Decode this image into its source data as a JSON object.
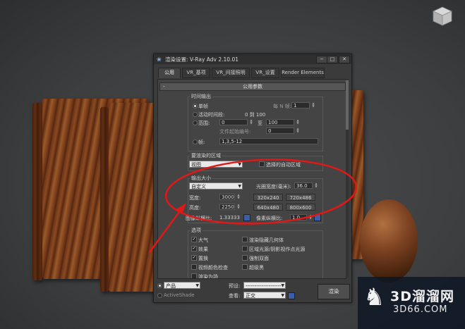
{
  "window": {
    "title": "渲染设置: V-Ray Adv 2.10.01",
    "btn_min": "−",
    "btn_max": "□",
    "btn_close": "✕"
  },
  "tabs": [
    {
      "label": "公用",
      "active": true
    },
    {
      "label": "VR_基项",
      "active": false
    },
    {
      "label": "VR_间接照明",
      "active": false
    },
    {
      "label": "VR_设置",
      "active": false
    },
    {
      "label": "Render Elements",
      "active": false
    }
  ],
  "rollout": {
    "sign": "-",
    "title": "公用参数"
  },
  "time_output": {
    "title": "时间输出",
    "single": "单帧",
    "every_n": "每 N 帧:",
    "every_n_value": "1",
    "active_segment": "活动时间段:",
    "active_segment_value": "0 到 100",
    "range": "范围:",
    "range_from": "0",
    "range_to_label": "至",
    "range_to": "100",
    "file_start": "文件起始编号:",
    "file_start_value": "0",
    "frames": "帧:",
    "frames_value": "1,3,5-12"
  },
  "area": {
    "title": "要渲染的区域",
    "select_value": "视图",
    "auto_region": "选择的自动区域"
  },
  "output_size": {
    "title": "输出大小",
    "preset_value": "自定义",
    "aperture_label": "光圈宽度(毫米):",
    "aperture_value": "36.0",
    "width_label": "宽度:",
    "width_value": "3000",
    "height_label": "高度:",
    "height_value": "2250",
    "presets": [
      "320x240",
      "720x486",
      "640x480",
      "800x600"
    ],
    "image_aspect_label": "图像纵横比:",
    "image_aspect_value": "1.33333",
    "pixel_aspect_label": "像素纵横比:",
    "pixel_aspect_value": "1.0"
  },
  "options": {
    "title": "选项",
    "left": [
      {
        "label": "大气",
        "checked": true
      },
      {
        "label": "效果",
        "checked": true
      },
      {
        "label": "置换",
        "checked": true
      },
      {
        "label": "视频颜色检查",
        "checked": false
      },
      {
        "label": "渲染为场",
        "checked": false
      }
    ],
    "right": [
      {
        "label": "渲染隐藏几何体",
        "checked": false
      },
      {
        "label": "区域光源/阴影视作点光源",
        "checked": false
      },
      {
        "label": "强制双面",
        "checked": false
      },
      {
        "label": "超级黑",
        "checked": false
      }
    ]
  },
  "bottom": {
    "product": "产品",
    "activeshade": "ActiveShade",
    "preset_label": "预设:",
    "preset_value": "--------------------",
    "view_label": "查看:",
    "view_value": "正交",
    "render": "渲染"
  },
  "watermark": {
    "site_cn": "3D溜溜网",
    "site_url": "3D66.COM"
  }
}
